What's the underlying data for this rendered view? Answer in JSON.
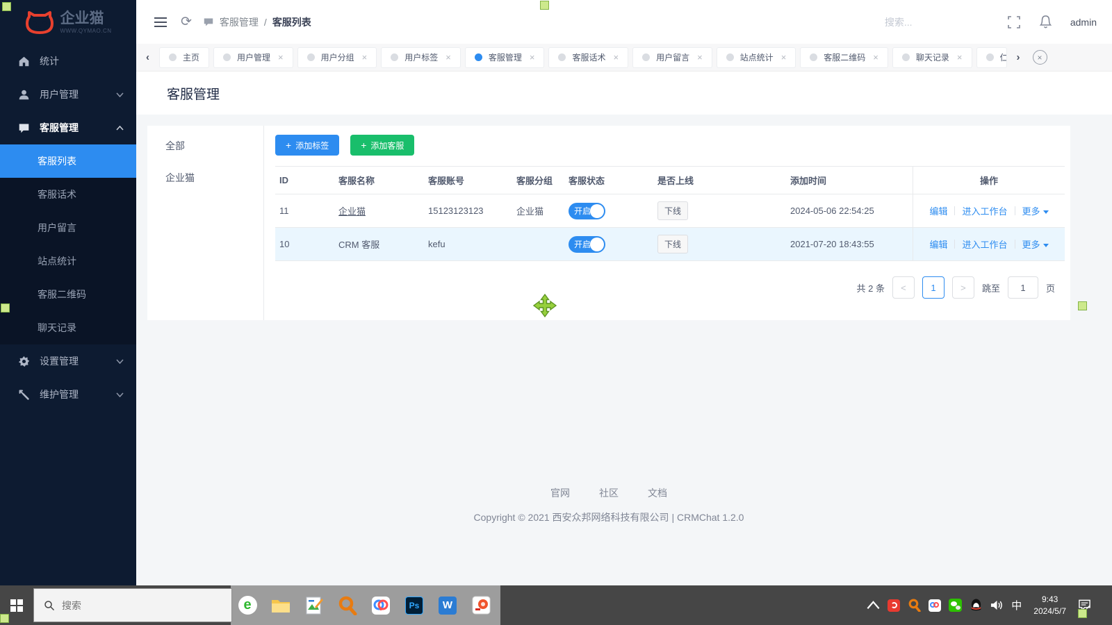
{
  "sidebar": {
    "logo_title": "企业猫",
    "logo_subtitle": "WWW.QYMAO.CN",
    "items": [
      {
        "label": "统计",
        "icon": "home-icon"
      },
      {
        "label": "用户管理",
        "icon": "user-icon",
        "chevron": "down"
      },
      {
        "label": "客服管理",
        "icon": "chat-icon",
        "chevron": "up",
        "expanded": true,
        "children": [
          "客服列表",
          "客服话术",
          "用户留言",
          "站点统计",
          "客服二维码",
          "聊天记录"
        ],
        "active_child": "客服列表"
      },
      {
        "label": "设置管理",
        "icon": "gear-icon",
        "chevron": "down"
      },
      {
        "label": "维护管理",
        "icon": "wrench-icon",
        "chevron": "down"
      }
    ]
  },
  "header": {
    "breadcrumb_parent": "客服管理",
    "breadcrumb_current": "客服列表",
    "search_placeholder": "搜索...",
    "user": "admin"
  },
  "tabbar": {
    "tabs": [
      {
        "label": "主页",
        "closable": false
      },
      {
        "label": "用户管理"
      },
      {
        "label": "用户分组"
      },
      {
        "label": "用户标签"
      },
      {
        "label": "客服管理",
        "active": true
      },
      {
        "label": "客服话术"
      },
      {
        "label": "用户留言"
      },
      {
        "label": "站点统计"
      },
      {
        "label": "客服二维码"
      },
      {
        "label": "聊天记录"
      },
      {
        "label": "仁",
        "partial": true
      }
    ]
  },
  "page": {
    "title": "客服管理",
    "groups": [
      "全部",
      "企业猫"
    ],
    "add_tag_label": "添加标签",
    "add_kefu_label": "添加客服",
    "accent_blue": "#2d8cf0",
    "accent_green": "#19be6b"
  },
  "table": {
    "columns": [
      "ID",
      "客服名称",
      "客服账号",
      "客服分组",
      "客服状态",
      "是否上线",
      "添加时间",
      "操作"
    ],
    "rows": [
      {
        "id": "11",
        "name": "企业猫",
        "underline": true,
        "account": "15123123123",
        "group": "企业猫",
        "status": "开启",
        "online": "下线",
        "time": "2024-05-06 22:54:25"
      },
      {
        "id": "10",
        "name": "CRM 客服",
        "account": "kefu",
        "group": "",
        "status": "开启",
        "online": "下线",
        "time": "2021-07-20 18:43:55",
        "highlight": true
      }
    ],
    "actions": [
      "编辑",
      "进入工作台",
      "更多"
    ]
  },
  "pagination": {
    "total": "共 2 条",
    "prev": "<",
    "page": "1",
    "next": ">",
    "jump_label": "跳至",
    "jump_value": "1",
    "page_suffix": "页"
  },
  "footer": {
    "links": [
      "官网",
      "社区",
      "文档"
    ],
    "copyright": "Copyright © 2021 西安众邦网络科技有限公司 | CRMChat 1.2.0"
  },
  "taskbar": {
    "search_placeholder": "搜索",
    "time": "9:43",
    "date": "2024/5/7",
    "input_indicator": "中"
  }
}
